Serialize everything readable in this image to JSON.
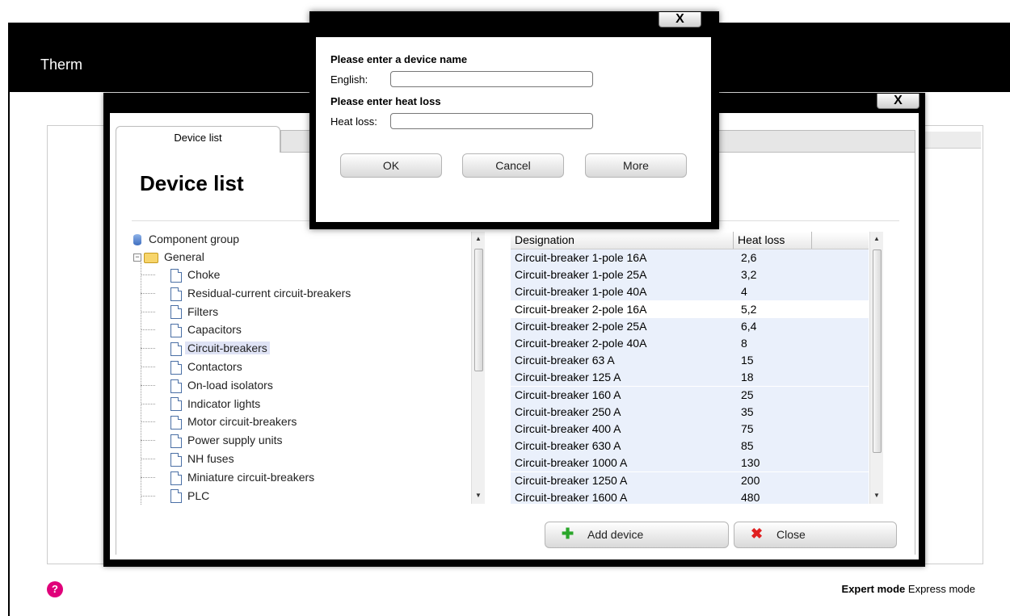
{
  "app": {
    "title": "Therm"
  },
  "footer": {
    "help_symbol": "?",
    "expert_mode": "Expert mode",
    "express_mode": "Express mode"
  },
  "device_list_window": {
    "close_label": "X",
    "tabs": [
      {
        "label": "Device list",
        "active": true
      },
      {
        "label": "",
        "active": false
      }
    ],
    "heading": "Device list",
    "tree": {
      "root": "Component group",
      "folder": "General",
      "items": [
        "Choke",
        "Residual-current circuit-breakers",
        "Filters",
        "Capacitors",
        "Circuit-breakers",
        "Contactors",
        "On-load isolators",
        "Indicator lights",
        "Motor circuit-breakers",
        "Power supply units",
        "NH fuses",
        "Miniature circuit-breakers",
        "PLC"
      ],
      "selected": "Circuit-breakers"
    },
    "table": {
      "columns": [
        "Designation",
        "Heat loss"
      ],
      "rows": [
        [
          "Circuit-breaker 1-pole 16A",
          "2,6"
        ],
        [
          "Circuit-breaker 1-pole 25A",
          "3,2"
        ],
        [
          "Circuit-breaker 1-pole 40A",
          "4"
        ],
        [
          "Circuit-breaker 2-pole 16A",
          "5,2"
        ],
        [
          "Circuit-breaker 2-pole 25A",
          "6,4"
        ],
        [
          "Circuit-breaker 2-pole 40A",
          "8"
        ],
        [
          "Circuit-breaker 63 A",
          "15"
        ],
        [
          "Circuit-breaker 125 A",
          "18"
        ],
        [
          "Circuit-breaker 160 A",
          "25"
        ],
        [
          "Circuit-breaker 250 A",
          "35"
        ],
        [
          "Circuit-breaker 400 A",
          "75"
        ],
        [
          "Circuit-breaker 630 A",
          "85"
        ],
        [
          "Circuit-breaker 1000 A",
          "130"
        ],
        [
          "Circuit-breaker 1250 A",
          "200"
        ],
        [
          "Circuit-breaker 1600 A",
          "480"
        ]
      ]
    },
    "buttons": {
      "add_device": "Add device",
      "close": "Close"
    }
  },
  "dialog": {
    "close_label": "X",
    "device_name_prompt": "Please enter a device name",
    "english_label": "English:",
    "english_value": "",
    "heat_loss_prompt": "Please enter heat loss",
    "heat_loss_label": "Heat loss:",
    "heat_loss_value": "",
    "ok": "OK",
    "cancel": "Cancel",
    "more": "More"
  },
  "colors": {
    "brand_accent": "#e0007a",
    "header_bg": "#000000",
    "row_highlight": "#eaf0fb",
    "selection": "#dfe3f5"
  }
}
